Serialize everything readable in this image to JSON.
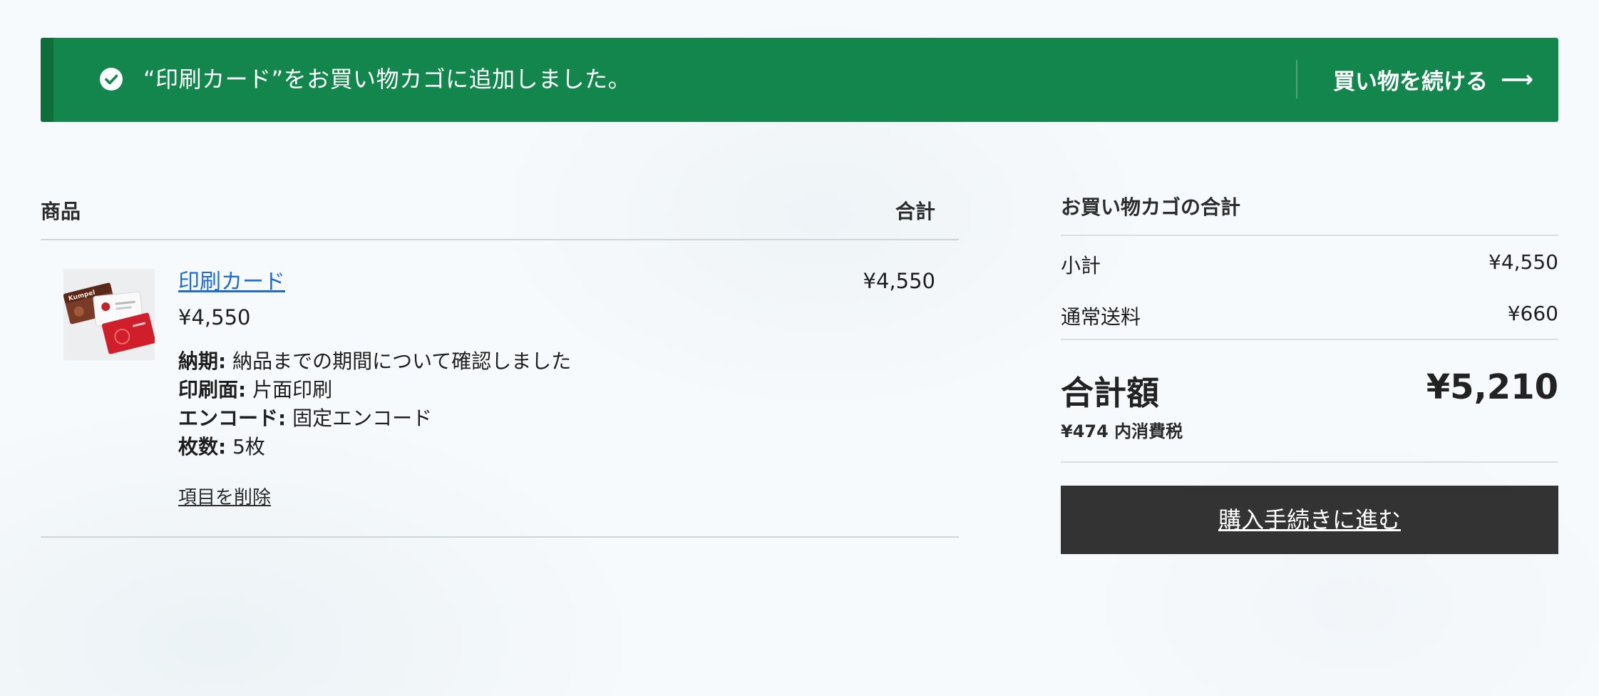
{
  "notice": {
    "message": "“印刷カード”をお買い物カゴに追加しました。",
    "continue_label": "買い物を続ける",
    "icon": "check-circle-icon",
    "continue_icon": "arrow-right-icon",
    "accent_color": "#13864d"
  },
  "cart": {
    "headers": {
      "product": "商品",
      "total": "合計"
    },
    "items": [
      {
        "name": "印刷カード",
        "price": "¥4,550",
        "line_total": "¥4,550",
        "thumbnail": "card-product-thumbnail",
        "meta": [
          {
            "key": "納期:",
            "value": "納品までの期間について確認しました"
          },
          {
            "key": "印刷面:",
            "value": "片面印刷"
          },
          {
            "key": "エンコード:",
            "value": "固定エンコード"
          },
          {
            "key": "枚数:",
            "value": "5枚"
          }
        ],
        "remove_label": "項目を削除"
      }
    ]
  },
  "totals": {
    "title": "お買い物カゴの合計",
    "subtotal_label": "小計",
    "subtotal_value": "¥4,550",
    "shipping_label": "通常送料",
    "shipping_value": "¥660",
    "grand_label": "合計額",
    "grand_value": "¥5,210",
    "tax_note": "¥474 内消費税",
    "checkout_label": "購入手続きに進む"
  }
}
